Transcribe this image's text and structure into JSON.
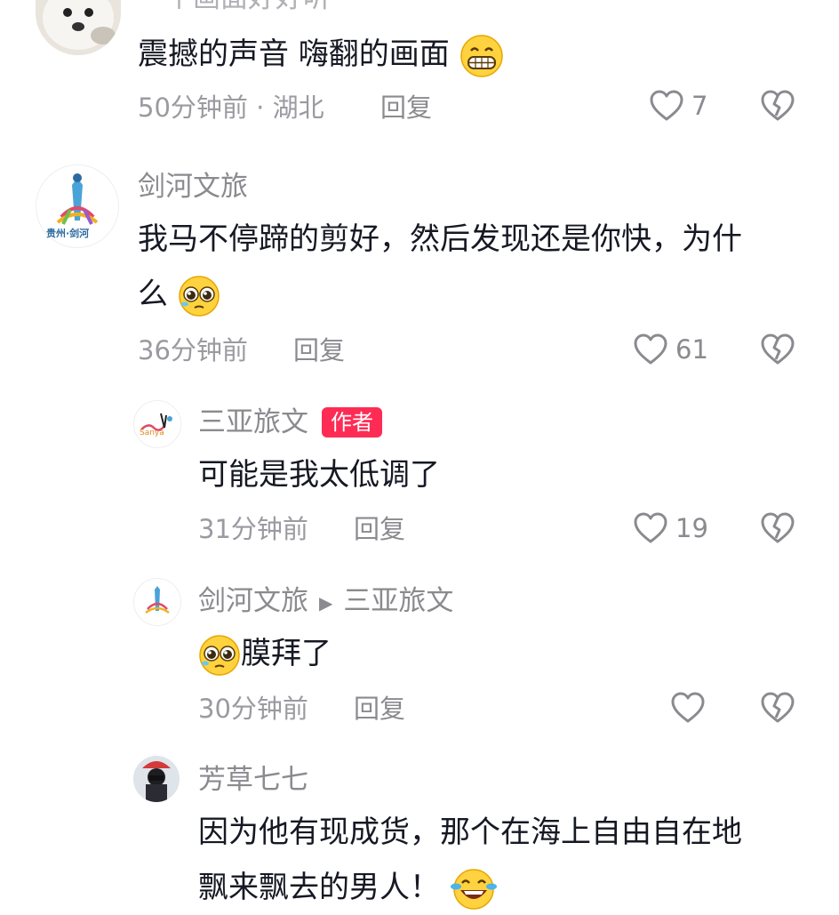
{
  "comments": [
    {
      "user": "一个画面好好听",
      "text": "震撼的声音 嗨翻的画面",
      "emoji": "grin",
      "time": "50分钟前",
      "location": "湖北",
      "reply": "回复",
      "likes": "7"
    },
    {
      "user": "剑河文旅",
      "avatar_caption": "贵州·剑河",
      "text_line1": "我马不停蹄的剪好，然后发现还是你快，为什",
      "text_line2": "么",
      "emoji": "pleading-face",
      "time": "36分钟前",
      "reply": "回复",
      "likes": "61"
    },
    {
      "user": "三亚旅文",
      "badge": "作者",
      "text": "可能是我太低调了",
      "time": "31分钟前",
      "reply": "回复",
      "likes": "19"
    },
    {
      "user": "剑河文旅",
      "reply_to": "三亚旅文",
      "emoji": "pleading-face",
      "text": "膜拜了",
      "time": "30分钟前",
      "reply": "回复",
      "likes": ""
    },
    {
      "user": "芳草七七",
      "text_line1": "因为他有现成货，那个在海上自由自在地",
      "text_line2": "飘来飘去的男人！",
      "emoji": "tears-of-joy"
    }
  ],
  "icons": {
    "like": "heart-outline-icon",
    "dislike": "broken-heart-icon",
    "reply_arrow": "triangle-right-icon"
  },
  "colors": {
    "author_badge": "#fe2c55",
    "meta_text": "#9a9aa0",
    "body_text": "#161823"
  }
}
